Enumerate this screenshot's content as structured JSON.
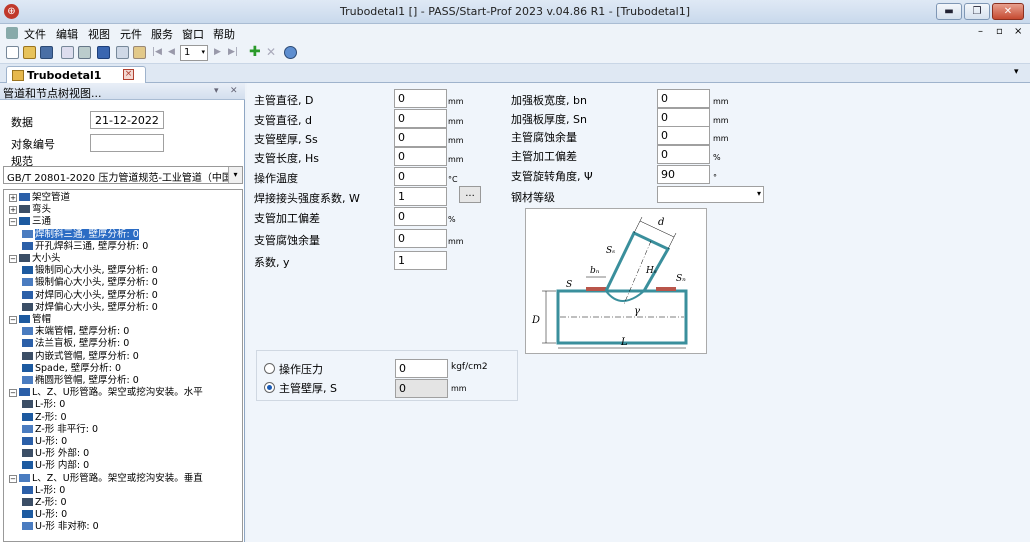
{
  "window": {
    "title": "Trubodetal1 [] - PASS/Start-Prof 2023 v.04.86 R1 - [Trubodetal1]",
    "app_icon": "pass-logo-icon",
    "buttons": {
      "minimize": "▬",
      "maximize": "❐",
      "close": "✕"
    }
  },
  "menu": {
    "items": [
      "文件",
      "编辑",
      "视图",
      "元件",
      "服务",
      "窗口",
      "帮助"
    ],
    "right_controls": [
      "–",
      "▫",
      "×"
    ]
  },
  "toolbar": {
    "page_value": "1"
  },
  "tab": {
    "label": "Trubodetal1",
    "collapse": "▾"
  },
  "left_panel": {
    "header": "管道和节点树视图...",
    "header_buttons": [
      "▾",
      "✕"
    ],
    "data_label": "数据",
    "date_value": "21-12-2022",
    "object_id_label": "对象编号",
    "object_id_value": "",
    "norm_label": "规范",
    "norm_value": "GB/T 20801-2020 压力管道规范-工业管道（中国）",
    "tree": [
      {
        "id": "t1",
        "depth": 0,
        "pm": "+",
        "text": "架空管道"
      },
      {
        "id": "t2",
        "depth": 0,
        "pm": "+",
        "text": "弯头"
      },
      {
        "id": "t3",
        "depth": 0,
        "pm": "-",
        "text": "三通"
      },
      {
        "id": "t4",
        "depth": 1,
        "text": "焊制斜三通, 壁厚分析: 0",
        "selected": true
      },
      {
        "id": "t5",
        "depth": 1,
        "text": "开孔焊斜三通, 壁厚分析: 0"
      },
      {
        "id": "t6",
        "depth": 0,
        "pm": "-",
        "text": "大小头"
      },
      {
        "id": "t7",
        "depth": 1,
        "text": "锻制同心大小头, 壁厚分析: 0"
      },
      {
        "id": "t8",
        "depth": 1,
        "text": "锻制偏心大小头, 壁厚分析: 0"
      },
      {
        "id": "t9",
        "depth": 1,
        "text": "对焊同心大小头, 壁厚分析: 0"
      },
      {
        "id": "t10",
        "depth": 1,
        "text": "对焊偏心大小头, 壁厚分析: 0"
      },
      {
        "id": "t11",
        "depth": 0,
        "pm": "-",
        "text": "管帽"
      },
      {
        "id": "t12",
        "depth": 1,
        "text": "末端管帽, 壁厚分析: 0"
      },
      {
        "id": "t13",
        "depth": 1,
        "text": "法兰盲板, 壁厚分析: 0"
      },
      {
        "id": "t14",
        "depth": 1,
        "text": "内嵌式管帽, 壁厚分析: 0"
      },
      {
        "id": "t15",
        "depth": 1,
        "text": "Spade, 壁厚分析: 0"
      },
      {
        "id": "t16",
        "depth": 1,
        "text": "椭圆形管帽, 壁厚分析: 0"
      },
      {
        "id": "t17",
        "depth": 0,
        "pm": "-",
        "text": "L、Z、U形管路。架空或挖沟安装。水平"
      },
      {
        "id": "t18",
        "depth": 1,
        "text": "L-形: 0"
      },
      {
        "id": "t19",
        "depth": 1,
        "text": "Z-形: 0"
      },
      {
        "id": "t20",
        "depth": 1,
        "text": "Z-形 非平行: 0"
      },
      {
        "id": "t21",
        "depth": 1,
        "text": "U-形: 0"
      },
      {
        "id": "t22",
        "depth": 1,
        "text": "U-形 外部: 0"
      },
      {
        "id": "t23",
        "depth": 1,
        "text": "U-形 内部: 0"
      },
      {
        "id": "t24",
        "depth": 0,
        "pm": "-",
        "text": "L、Z、U形管路。架空或挖沟安装。垂直"
      },
      {
        "id": "t25",
        "depth": 1,
        "text": "L-形: 0"
      },
      {
        "id": "t26",
        "depth": 1,
        "text": "Z-形: 0"
      },
      {
        "id": "t27",
        "depth": 1,
        "text": "U-形: 0"
      },
      {
        "id": "t28",
        "depth": 1,
        "text": "U-形 非对称: 0"
      }
    ]
  },
  "form": {
    "left_fields": [
      {
        "id": "f_D",
        "label": "主管直径, D",
        "value": "0",
        "unit": "mm"
      },
      {
        "id": "f_d",
        "label": "支管直径, d",
        "value": "0",
        "unit": "mm"
      },
      {
        "id": "f_Ss",
        "label": "支管壁厚, Ss",
        "value": "0",
        "unit": "mm"
      },
      {
        "id": "f_Hs",
        "label": "支管长度, Hs",
        "value": "0",
        "unit": "mm"
      },
      {
        "id": "f_T",
        "label": "操作温度",
        "value": "0",
        "unit": "°C"
      },
      {
        "id": "f_W",
        "label": "焊接接头强度系数, W",
        "value": "1",
        "unit": ""
      },
      {
        "id": "f_bu",
        "label": "支管加工偏差",
        "value": "0",
        "unit": "%"
      },
      {
        "id": "f_bc",
        "label": "支管腐蚀余量",
        "value": "0",
        "unit": "mm"
      },
      {
        "id": "f_y",
        "label": "系数, y",
        "value": "1",
        "unit": ""
      }
    ],
    "right_fields": [
      {
        "id": "f_bn",
        "label": "加强板宽度, bn",
        "value": "0",
        "unit": "mm"
      },
      {
        "id": "f_Sn",
        "label": "加强板厚度, Sn",
        "value": "0",
        "unit": "mm"
      },
      {
        "id": "f_mc",
        "label": "主管腐蚀余量",
        "value": "0",
        "unit": "mm"
      },
      {
        "id": "f_mu",
        "label": "主管加工偏差",
        "value": "0",
        "unit": "%"
      },
      {
        "id": "f_ang",
        "label": "支管旋转角度, Ψ",
        "value": "90",
        "unit": "°"
      }
    ],
    "steel_label": "钢材等级",
    "steel_value": "",
    "dots_label": "...",
    "radios": [
      {
        "id": "r1",
        "label": "操作压力",
        "value": "0",
        "unit": "kgf/cm2",
        "checked": false
      },
      {
        "id": "r2",
        "label": "主管壁厚, S",
        "value": "0",
        "unit": "mm",
        "checked": true
      }
    ]
  },
  "diagram": {
    "labels": {
      "d": "d",
      "Ss": "Sₛ",
      "bn": "bₙ",
      "Hs": "Hₛ",
      "Sn": "Sₙ",
      "S": "S",
      "D": "D",
      "psi": "γ",
      "L": "L"
    }
  }
}
